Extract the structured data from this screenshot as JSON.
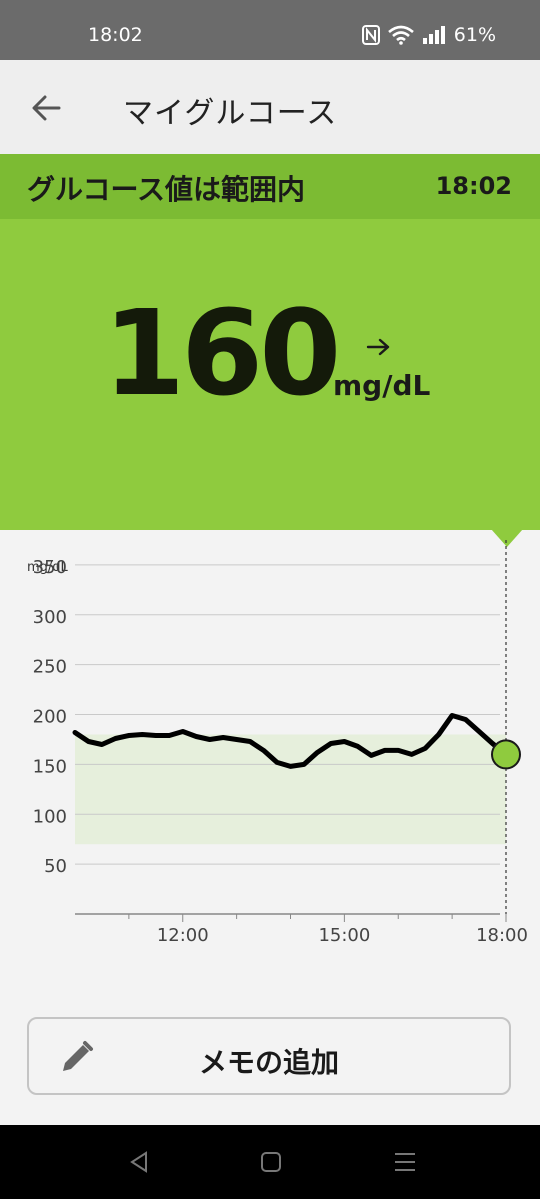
{
  "status_bar": {
    "time": "18:02",
    "battery": "61%",
    "icons": [
      "nfc-icon",
      "wifi-icon",
      "signal-icon"
    ]
  },
  "app_bar": {
    "title": "マイグルコース",
    "back_icon": "arrow-left-icon"
  },
  "banner": {
    "status": "グルコース値は範囲内",
    "time": "18:02"
  },
  "reading": {
    "value": "160",
    "unit": "mg/dL",
    "trend_icon": "arrow-right-icon"
  },
  "colors": {
    "banner": "#7cbb33",
    "reading_bg": "#8fcb3e",
    "target_range_fill": "#e6efdc",
    "line": "#000000"
  },
  "chart_data": {
    "type": "line",
    "ylabel": "mg/dL",
    "ylim": [
      0,
      375
    ],
    "y_ticks": [
      50,
      100,
      150,
      200,
      250,
      300,
      350
    ],
    "x_ticks": [
      "12:00",
      "15:00",
      "18:00"
    ],
    "xlim_hours": [
      10.0,
      18.0
    ],
    "target_range": [
      70,
      180
    ],
    "grid": true,
    "series": [
      {
        "x": [
          10.0,
          10.25,
          10.5,
          10.75,
          11.0,
          11.25,
          11.5,
          11.75,
          12.0,
          12.25,
          12.5,
          12.75,
          13.0,
          13.25,
          13.5,
          13.75,
          14.0,
          14.25,
          14.5,
          14.75,
          15.0,
          15.25,
          15.5,
          15.75,
          16.0,
          16.25,
          16.5,
          16.75,
          17.0,
          17.25,
          17.5,
          17.75,
          18.0
        ],
        "values": [
          182,
          173,
          170,
          176,
          179,
          180,
          179,
          179,
          183,
          178,
          175,
          177,
          175,
          173,
          164,
          152,
          148,
          150,
          162,
          171,
          173,
          168,
          159,
          164,
          164,
          160,
          166,
          180,
          199,
          195,
          183,
          171,
          160
        ]
      }
    ],
    "current_point": {
      "time": "18:02",
      "value": 160
    }
  },
  "memo": {
    "label": "メモの追加",
    "icon": "pencil-icon"
  },
  "nav": {
    "icons": [
      "back-triangle-icon",
      "home-square-icon",
      "recents-menu-icon"
    ]
  }
}
